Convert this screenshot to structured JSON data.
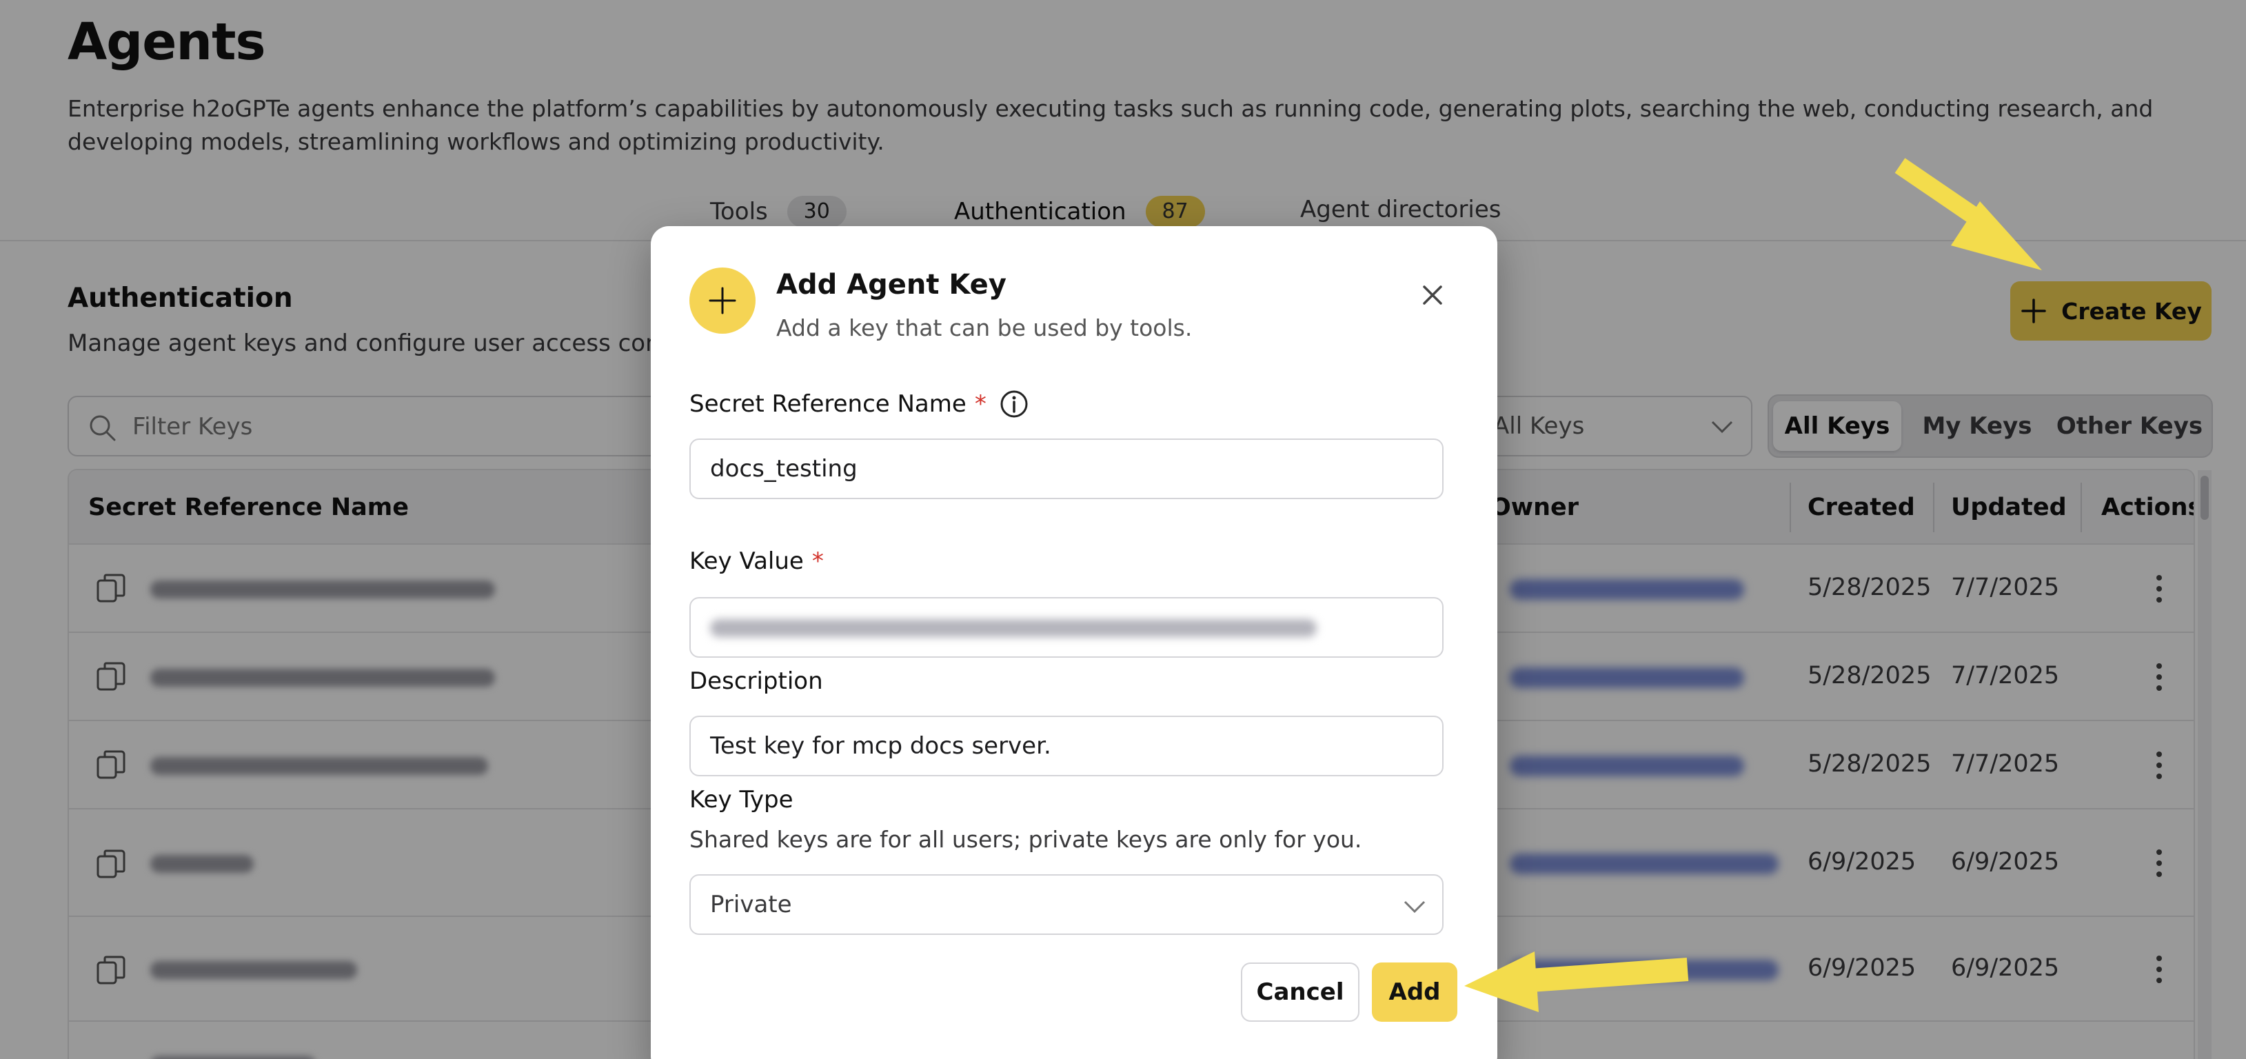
{
  "page": {
    "title": "Agents",
    "description": "Enterprise h2oGPTe agents enhance the platform’s capabilities by autonomously executing tasks such as running code, generating plots, searching the web, conducting research, and developing models, streamlining workflows and optimizing productivity."
  },
  "tabs": [
    {
      "label": "Tools",
      "count": "30"
    },
    {
      "label": "Authentication",
      "count": "87"
    },
    {
      "label": "Agent directories"
    }
  ],
  "section": {
    "title": "Authentication",
    "description": "Manage agent keys and configure user access controls"
  },
  "toolbar": {
    "create_label": "Create Key",
    "filter_placeholder": "Filter Keys",
    "scope_selected": "All Keys",
    "segments": [
      "All Keys",
      "My Keys",
      "Other Keys"
    ],
    "active_segment": "All Keys"
  },
  "table": {
    "columns": [
      "Secret Reference Name",
      "Owner",
      "Created",
      "Updated",
      "Actions"
    ],
    "rows": [
      {
        "created": "5/28/2025",
        "updated": "7/7/2025"
      },
      {
        "created": "5/28/2025",
        "updated": "7/7/2025"
      },
      {
        "created": "5/28/2025",
        "updated": "7/7/2025"
      },
      {
        "created": "6/9/2025",
        "updated": "6/9/2025"
      },
      {
        "created": "6/9/2025",
        "updated": "6/9/2025"
      }
    ]
  },
  "modal": {
    "title": "Add Agent Key",
    "subtitle": "Add a key that can be used by tools.",
    "fields": {
      "name_label": "Secret Reference Name",
      "name_value": "docs_testing",
      "key_label": "Key Value",
      "description_label": "Description",
      "description_value": "Test key for mcp docs server.",
      "type_label": "Key Type",
      "type_helper": "Shared keys are for all users; private keys are only for you.",
      "type_value": "Private"
    },
    "required_mark": "*",
    "cancel_label": "Cancel",
    "add_label": "Add"
  },
  "colors": {
    "accent": "#f5d454",
    "arrow": "#f3dc4c",
    "required": "#d2332b"
  }
}
